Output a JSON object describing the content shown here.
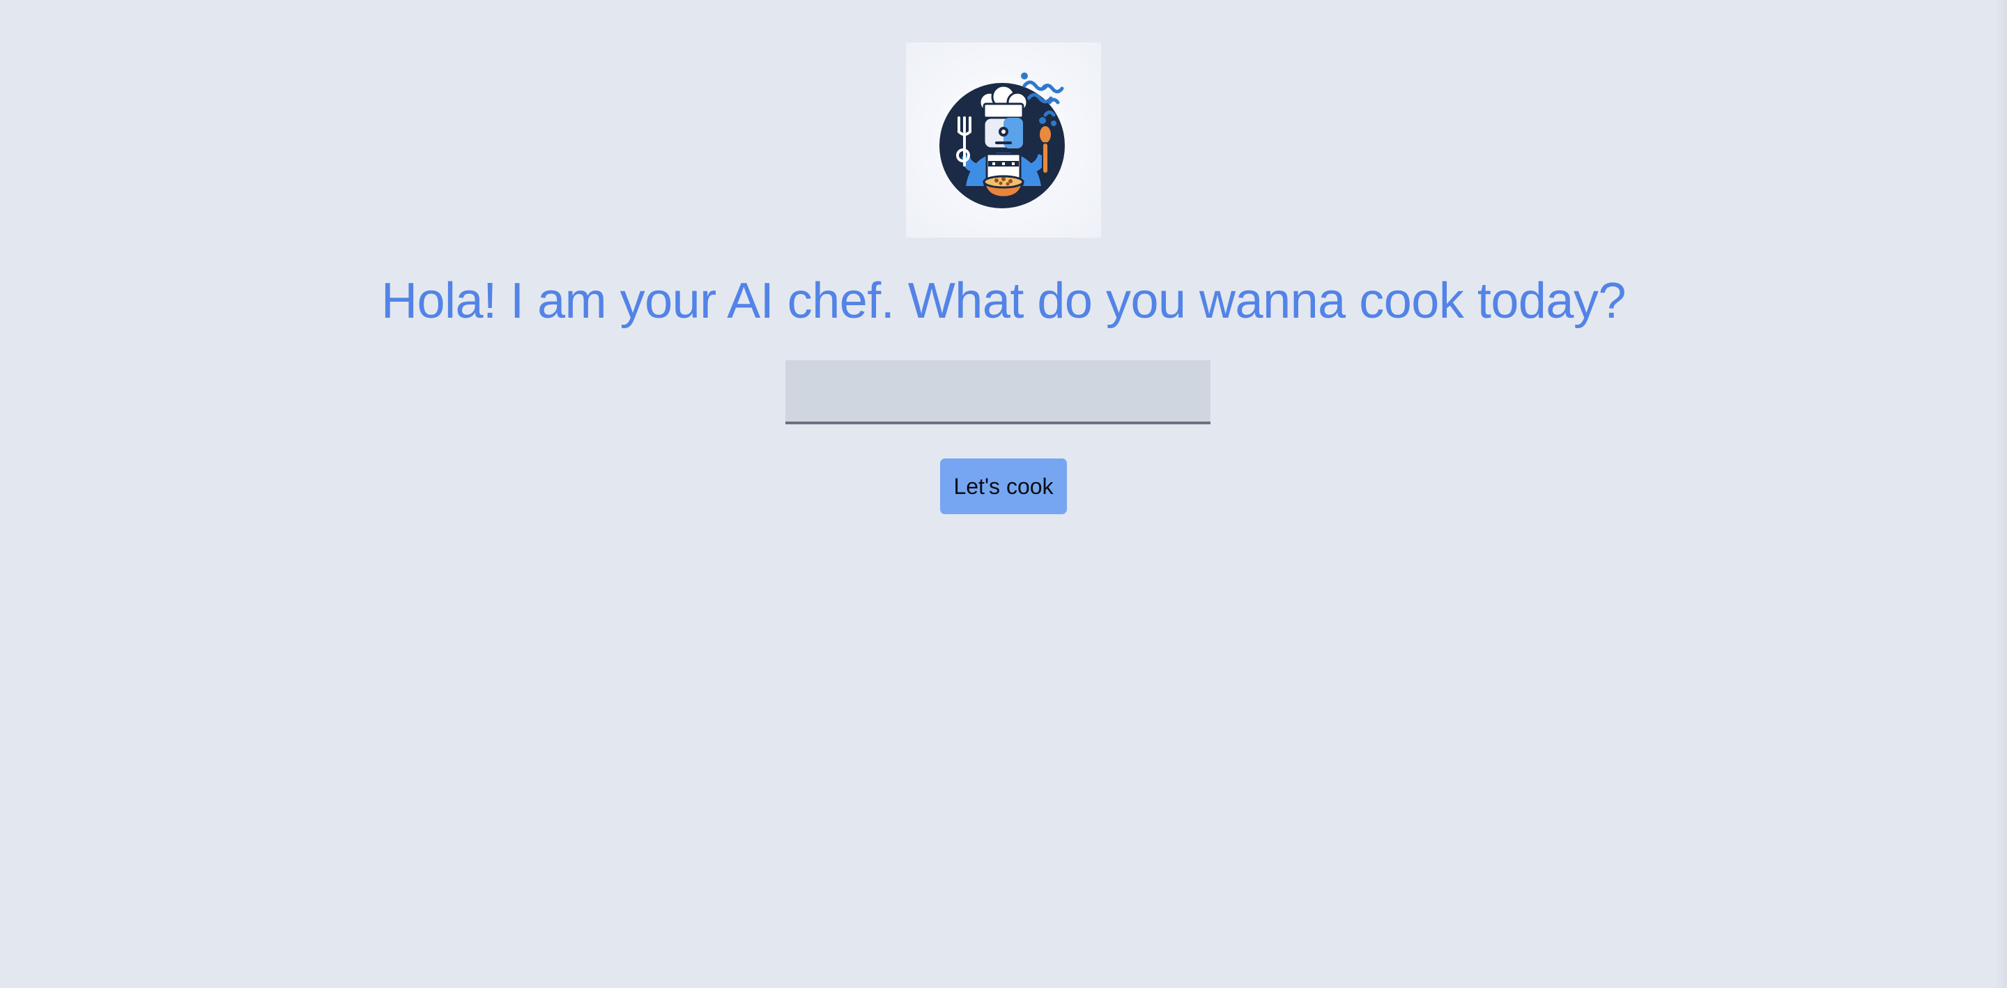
{
  "logo": {
    "icon": "ai-chef-robot-logo-icon"
  },
  "main": {
    "headline": "Hola! I am your AI chef. What do you wanna cook today?",
    "input": {
      "value": "",
      "placeholder": ""
    },
    "cook_button_label": "Let's cook"
  },
  "colors": {
    "background": "#e3e8f0",
    "headline": "#5383e6",
    "input_background": "#cfd6e0",
    "button_background": "#76a6f2"
  }
}
